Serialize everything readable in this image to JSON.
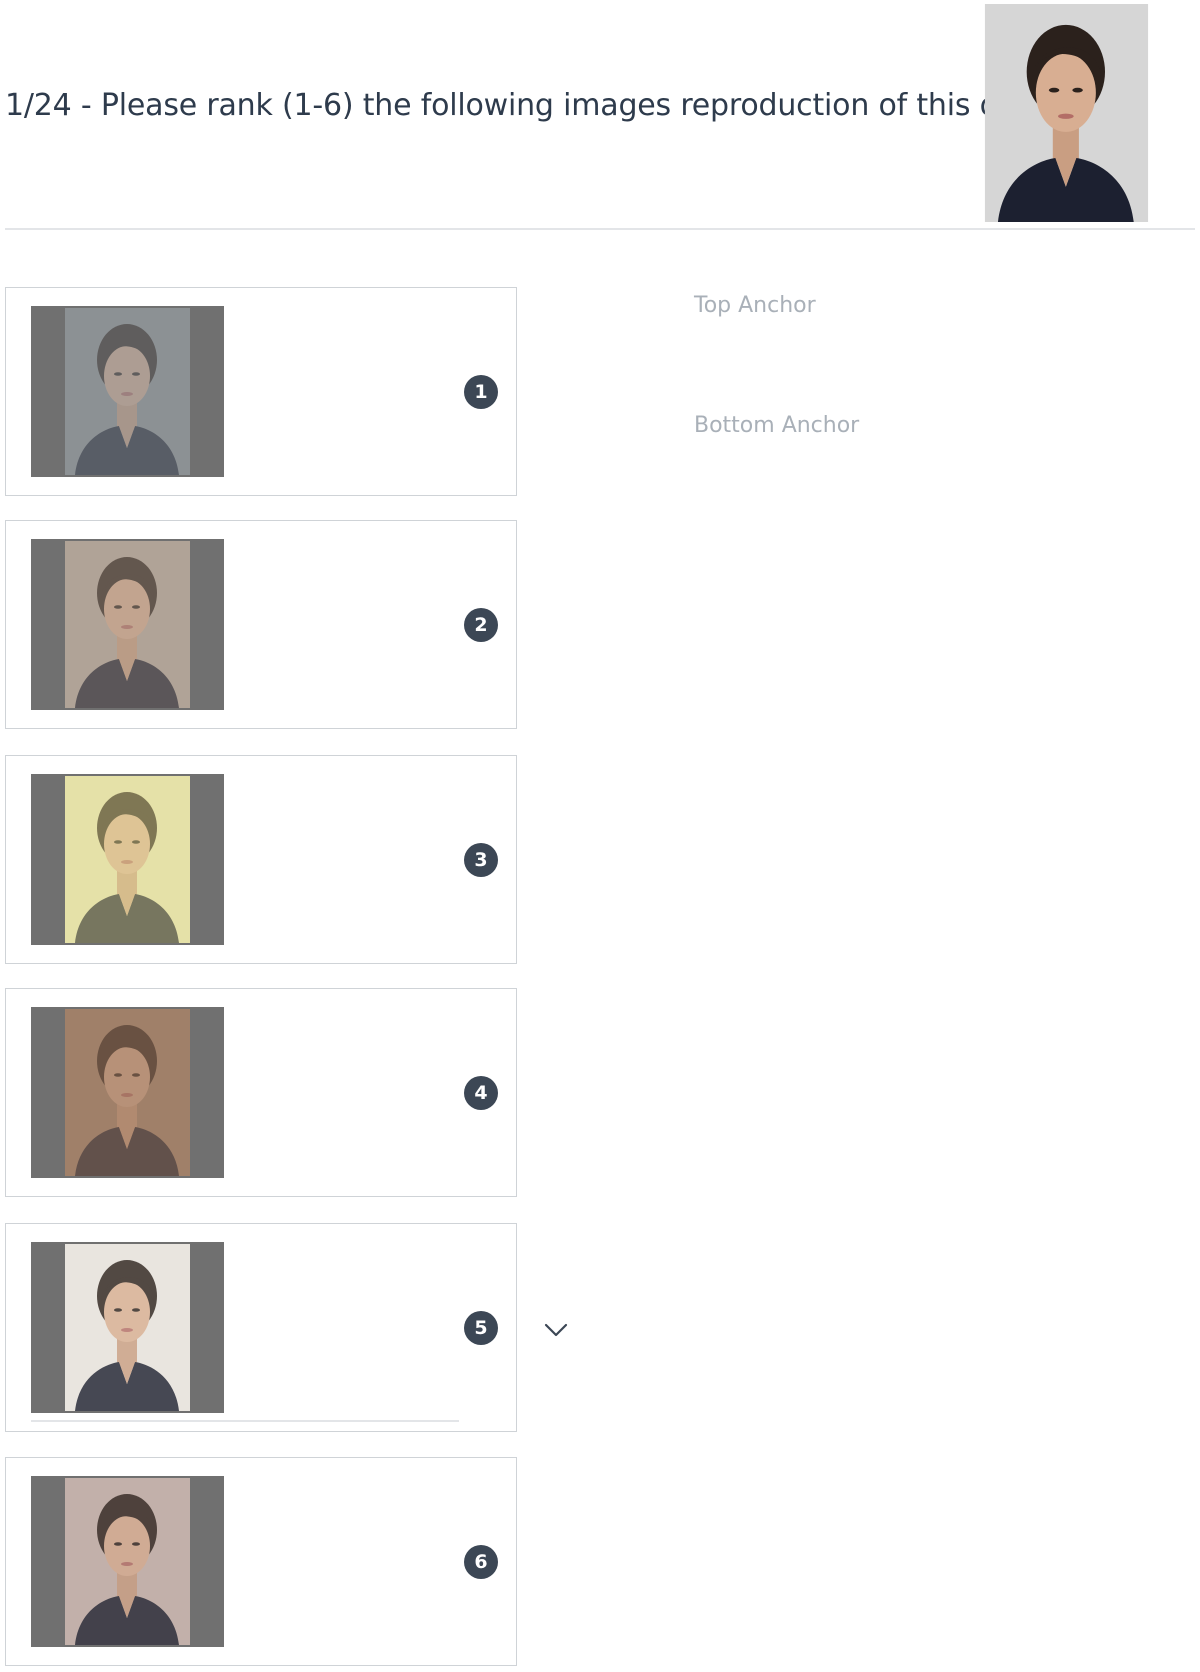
{
  "question": {
    "text": "1/24 - Please rank (1-6) the following images reproduction of this one :"
  },
  "reference_image": {
    "background": "#d6d6d6"
  },
  "cards": [
    {
      "rank": "1",
      "background": "#8f9396",
      "tint": "#8a8f93",
      "tint_opacity": 0.55
    },
    {
      "rank": "2",
      "background": "#b7aba0",
      "tint": "#a89a8c",
      "tint_opacity": 0.45
    },
    {
      "rank": "3",
      "background": "#e3e2b4",
      "tint": "#e6df9a",
      "tint_opacity": 0.45
    },
    {
      "rank": "4",
      "background": "#a58772",
      "tint": "#9c7a62",
      "tint_opacity": 0.55
    },
    {
      "rank": "5",
      "background": "#e8e4df",
      "tint": "#f2ebe2",
      "tint_opacity": 0.2
    },
    {
      "rank": "6",
      "background": "#c6b5af",
      "tint": "#b9a49c",
      "tint_opacity": 0.25
    }
  ],
  "anchors": {
    "top": "Top Anchor",
    "bottom": "Bottom Anchor"
  },
  "icons": {
    "dropdown": "chevron-down-icon"
  },
  "colors": {
    "badge": "#3c4755",
    "thumb_frame": "#707070",
    "anchor_text": "#a9b0b8"
  }
}
